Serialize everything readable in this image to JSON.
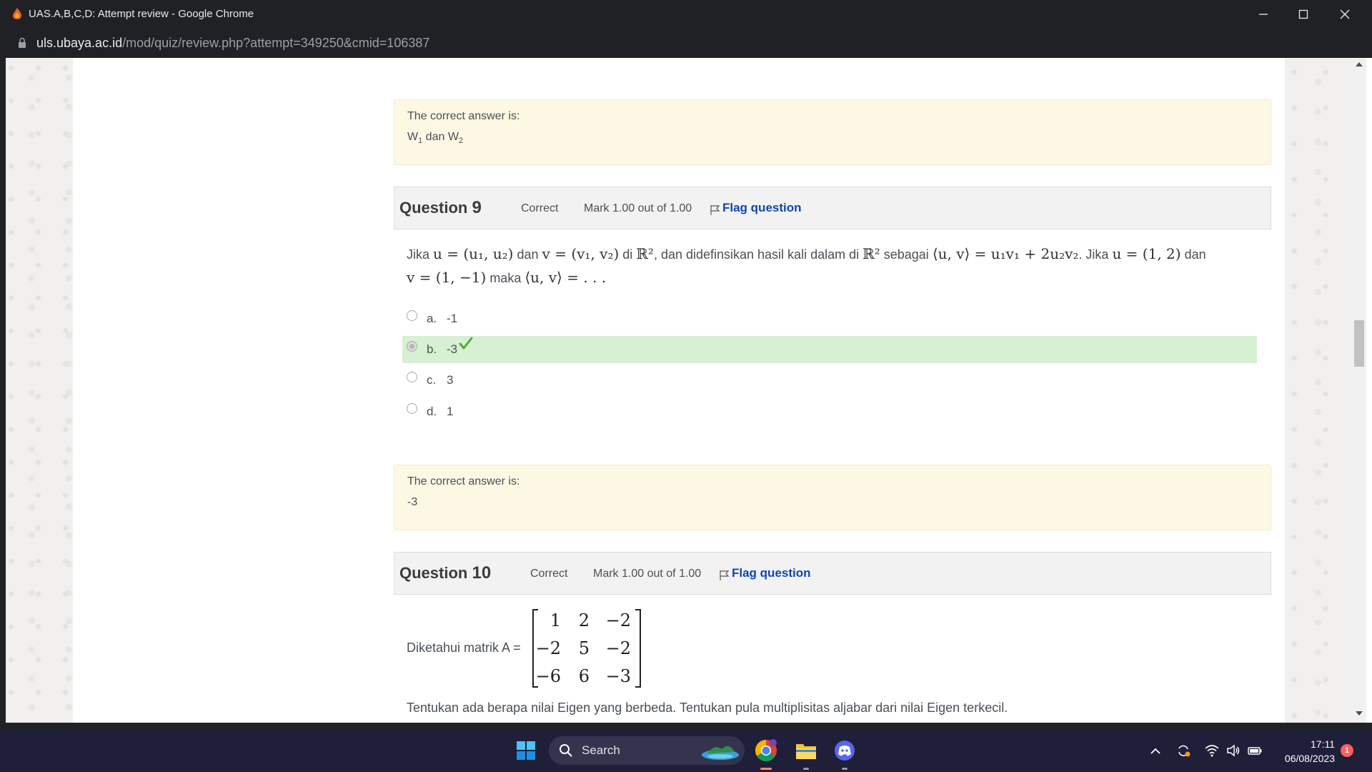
{
  "window": {
    "title": "UAS.A,B,C,D: Attempt review - Google Chrome",
    "url_host": "uls.ubaya.ac.id",
    "url_path": "/mod/quiz/review.php?attempt=349250&cmid=106387"
  },
  "prev_question": {
    "correct_answer_label": "The correct answer is:",
    "correct_answer_w1": "W",
    "correct_answer_sub1": "1",
    "correct_answer_mid": " dan W",
    "correct_answer_sub2": "2"
  },
  "question9": {
    "label": "Question",
    "number": "9",
    "state": "Correct",
    "grade": "Mark 1.00 out of 1.00",
    "flag_label": "Flag question",
    "text": {
      "p1": "Jika ",
      "p2": " dan ",
      "p3": " di ",
      "p4": ", dan didefinsikan hasil kali dalam di ",
      "p5": " sebagai ",
      "p6": ". Jika ",
      "p7": " dan ",
      "p8": " maka ",
      "m_u": "u = (u₁, u₂)",
      "m_v": "v = (v₁, v₂)",
      "m_r2": "ℝ²",
      "m_inner": "⟨u, v⟩ = u₁v₁ + 2u₂v₂",
      "m_u_val": "u = (1, 2)",
      "m_v_val": "v = (1, −1)",
      "m_ask": "⟨u, v⟩ = . . ."
    },
    "options": [
      {
        "letter": "a.",
        "text": "-1",
        "selected": false,
        "correct": false
      },
      {
        "letter": "b.",
        "text": "-3",
        "selected": true,
        "correct": true
      },
      {
        "letter": "c.",
        "text": "3",
        "selected": false,
        "correct": false
      },
      {
        "letter": "d.",
        "text": "1",
        "selected": false,
        "correct": false
      }
    ],
    "correct_answer_label": "The correct answer is:",
    "correct_answer": "-3"
  },
  "question10": {
    "label": "Question",
    "number": "10",
    "state": "Correct",
    "grade": "Mark 1.00 out of 1.00",
    "flag_label": "Flag question",
    "matrix_intro": "Diketahui matrik A =",
    "matrix": [
      [
        "1",
        "2",
        "−2"
      ],
      [
        "−2",
        "5",
        "−2"
      ],
      [
        "−6",
        "6",
        "−3"
      ]
    ],
    "instruction": "Tentukan ada berapa nilai Eigen yang berbeda.  Tentukan pula multiplisitas aljabar dari nilai Eigen terkecil."
  },
  "taskbar": {
    "search_label": "Search",
    "time": "17:11",
    "date": "06/08/2023",
    "notification_count": "1"
  },
  "colors": {
    "flag_link": "#0f47ad",
    "correct_bg": "#d7efd2",
    "answer_bg": "#fcf8e3",
    "check": "#5aa83a"
  }
}
